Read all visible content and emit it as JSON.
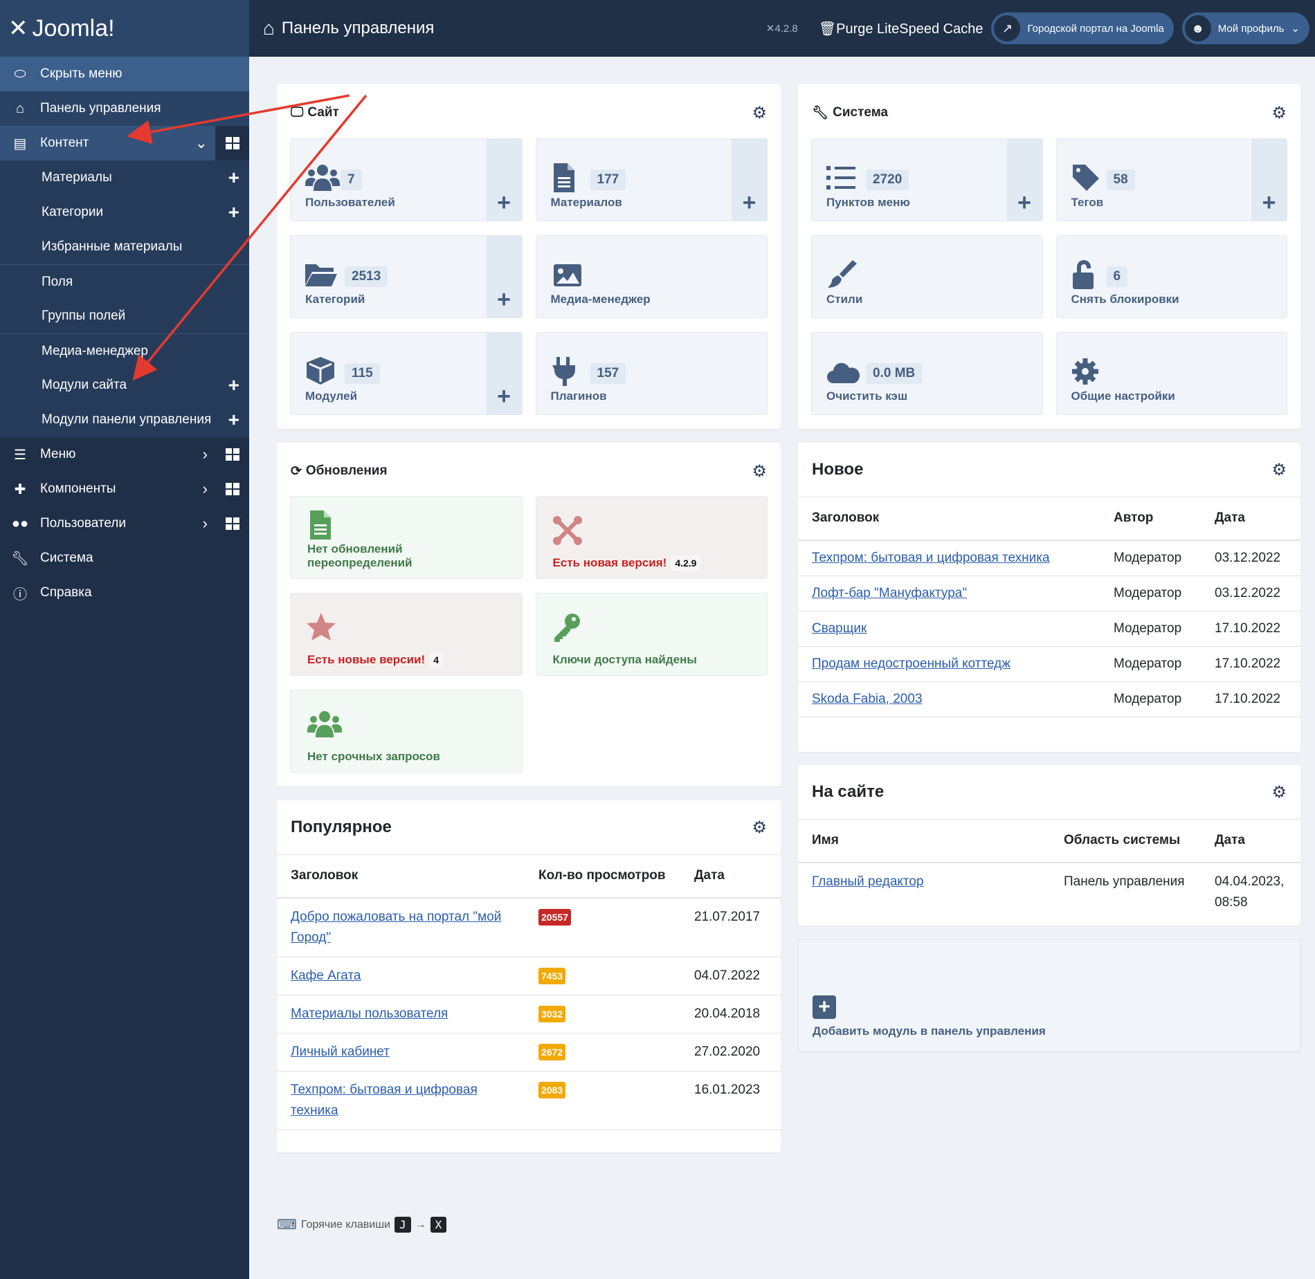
{
  "app": {
    "logo_text": "Joomla!",
    "title": "Панель управления",
    "version": "4.2.8",
    "purge": "Purge LiteSpeed Cache",
    "site_link": "Городской портал на Joomla",
    "profile": "Мой профиль"
  },
  "sidebar": {
    "toggle": "Скрыть меню",
    "dashboard": "Панель управления",
    "content": "Контент",
    "content_items": [
      {
        "label": "Материалы",
        "add": true
      },
      {
        "label": "Категории",
        "add": true
      },
      {
        "label": "Избранные материалы",
        "add": false
      },
      {
        "label": "Поля",
        "add": false
      },
      {
        "label": "Группы полей",
        "add": false
      },
      {
        "label": "Медиа-менеджер",
        "add": false
      },
      {
        "label": "Модули сайта",
        "add": true
      },
      {
        "label": "Модули панели управления",
        "add": true
      }
    ],
    "menus": "Меню",
    "components": "Компоненты",
    "users": "Пользователи",
    "system": "Система",
    "help": "Справка"
  },
  "site": {
    "title": "Сайт",
    "tiles": [
      {
        "icon": "users",
        "count": "7",
        "label": "Пользователей",
        "add": true
      },
      {
        "icon": "file",
        "count": "177",
        "label": "Материалов",
        "add": true
      },
      {
        "icon": "folder",
        "count": "2513",
        "label": "Категорий",
        "add": true
      },
      {
        "icon": "image",
        "count": "",
        "label": "Медиа-менеджер",
        "add": false
      },
      {
        "icon": "cube",
        "count": "115",
        "label": "Модулей",
        "add": true
      },
      {
        "icon": "plug",
        "count": "157",
        "label": "Плагинов",
        "add": false
      }
    ]
  },
  "system": {
    "title": "Система",
    "tiles": [
      {
        "icon": "list",
        "count": "2720",
        "label": "Пунктов меню",
        "add": true
      },
      {
        "icon": "tag",
        "count": "58",
        "label": "Тегов",
        "add": true
      },
      {
        "icon": "brush",
        "count": "",
        "label": "Стили",
        "add": false
      },
      {
        "icon": "unlock",
        "count": "6",
        "label": "Снять блокировки",
        "add": false
      },
      {
        "icon": "cloud",
        "count": "0.0 MB",
        "label": "Очистить кэш",
        "add": false
      },
      {
        "icon": "gear",
        "count": "",
        "label": "Общие настройки",
        "add": false
      }
    ]
  },
  "updates": {
    "title": "Обновления",
    "tiles": [
      {
        "label": "Нет обновлений переопределений",
        "status": "ok",
        "icon": "file"
      },
      {
        "label": "Есть новая версия!",
        "badge": "4.2.9",
        "status": "warn",
        "icon": "joomla"
      },
      {
        "label": "Есть новые версии!",
        "badge": "4",
        "status": "warn",
        "icon": "star"
      },
      {
        "label": "Ключи доступа найдены",
        "status": "ok",
        "icon": "key"
      },
      {
        "label": "Нет срочных запросов",
        "status": "ok",
        "icon": "users"
      }
    ]
  },
  "popular": {
    "title": "Популярное",
    "columns": [
      "Заголовок",
      "Кол-во просмотров",
      "Дата"
    ],
    "rows": [
      {
        "title": "Добро пожаловать на портал \"мой Город\"",
        "hits": "20557",
        "date": "21.07.2017",
        "color": "#c52827"
      },
      {
        "title": "Кафе Агата",
        "hits": "7453",
        "date": "04.07.2022",
        "color": "#f2a900"
      },
      {
        "title": "Материалы пользователя",
        "hits": "3032",
        "date": "20.04.2018",
        "color": "#f2a900"
      },
      {
        "title": "Личный кабинет",
        "hits": "2672",
        "date": "27.02.2020",
        "color": "#f2a900"
      },
      {
        "title": "Техпром: бытовая и цифровая техника",
        "hits": "2083",
        "date": "16.01.2023",
        "color": "#f2a900"
      }
    ]
  },
  "latest": {
    "title": "Новое",
    "columns": [
      "Заголовок",
      "Автор",
      "Дата"
    ],
    "rows": [
      {
        "title": "Техпром: бытовая и цифровая техника",
        "author": "Модератор",
        "date": "03.12.2022"
      },
      {
        "title": "Лофт-бар \"Мануфактура\"",
        "author": "Модератор",
        "date": "03.12.2022"
      },
      {
        "title": "Сварщик",
        "author": "Модератор",
        "date": "17.10.2022"
      },
      {
        "title": "Продам недостроенный коттедж",
        "author": "Модератор",
        "date": "17.10.2022"
      },
      {
        "title": "Skoda Fabia, 2003",
        "author": "Модератор",
        "date": "17.10.2022"
      }
    ]
  },
  "logged": {
    "title": "На сайте",
    "columns": [
      "Имя",
      "Область системы",
      "Дата"
    ],
    "rows": [
      {
        "name": "Главный редактор",
        "area": "Панель управления",
        "date": "04.04.2023, 08:58"
      }
    ]
  },
  "add_module": "Добавить модуль в панель управления",
  "footer": {
    "hotkeys": "Горячие клавиши",
    "key1": "J",
    "arrow": "→",
    "key2": "X"
  },
  "colors": {
    "sidebar": "#1f2f48",
    "header": "#1f3047",
    "accent": "#3a5f8e",
    "tile_icon": "#465e80",
    "ok": "#3f7a4a",
    "warn": "#c8211f",
    "annotation_arrow": "#e53a2f"
  }
}
